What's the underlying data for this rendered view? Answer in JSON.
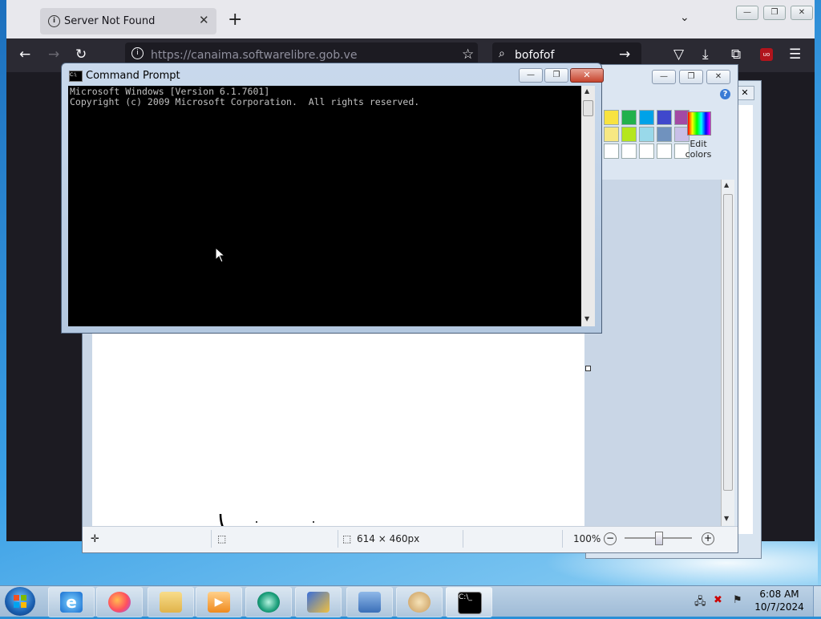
{
  "browser": {
    "tab_title": "Server Not Found",
    "tab_info_icon": "i",
    "tab_close": "✕",
    "new_tab": "+",
    "list_all_tabs": "⌄",
    "url": "https://canaima.softwarelibre.gob.ve",
    "search_text": "bofofof",
    "window_min": "—",
    "window_max": "❐",
    "window_close": "✕"
  },
  "cmd": {
    "title": "Command Prompt",
    "icon_text": "C:\\",
    "lines": "Microsoft Windows [Version 6.1.7601]\nCopyright (c) 2009 Microsoft Corporation.  All rights reserved.",
    "min": "—",
    "max": "❐",
    "close": "✕",
    "scroll_up": "▲",
    "scroll_down": "▼"
  },
  "paint": {
    "edit_colors": "Edit colors",
    "help": "?",
    "dimensions": "614 × 460px",
    "zoom": "100%",
    "zoom_out": "−",
    "zoom_in": "+",
    "min": "—",
    "max": "❐",
    "close": "✕",
    "back_close": "✕",
    "palette": [
      "#f8e340",
      "#22b14c",
      "#00a2e8",
      "#3f48cc",
      "#a349a4",
      "#f7e883",
      "#b5e61d",
      "#99d9ea",
      "#7092be",
      "#c8bfe7",
      "#ffffff",
      "#ffffff",
      "#ffffff",
      "#ffffff",
      "#ffffff"
    ]
  },
  "taskbar": {
    "time": "6:08 AM",
    "date": "10/7/2024",
    "apps": [
      "internet-explorer",
      "firefox",
      "file-explorer",
      "media-player",
      "browser-green",
      "installer",
      "control-panel",
      "paint",
      "command-prompt"
    ]
  }
}
